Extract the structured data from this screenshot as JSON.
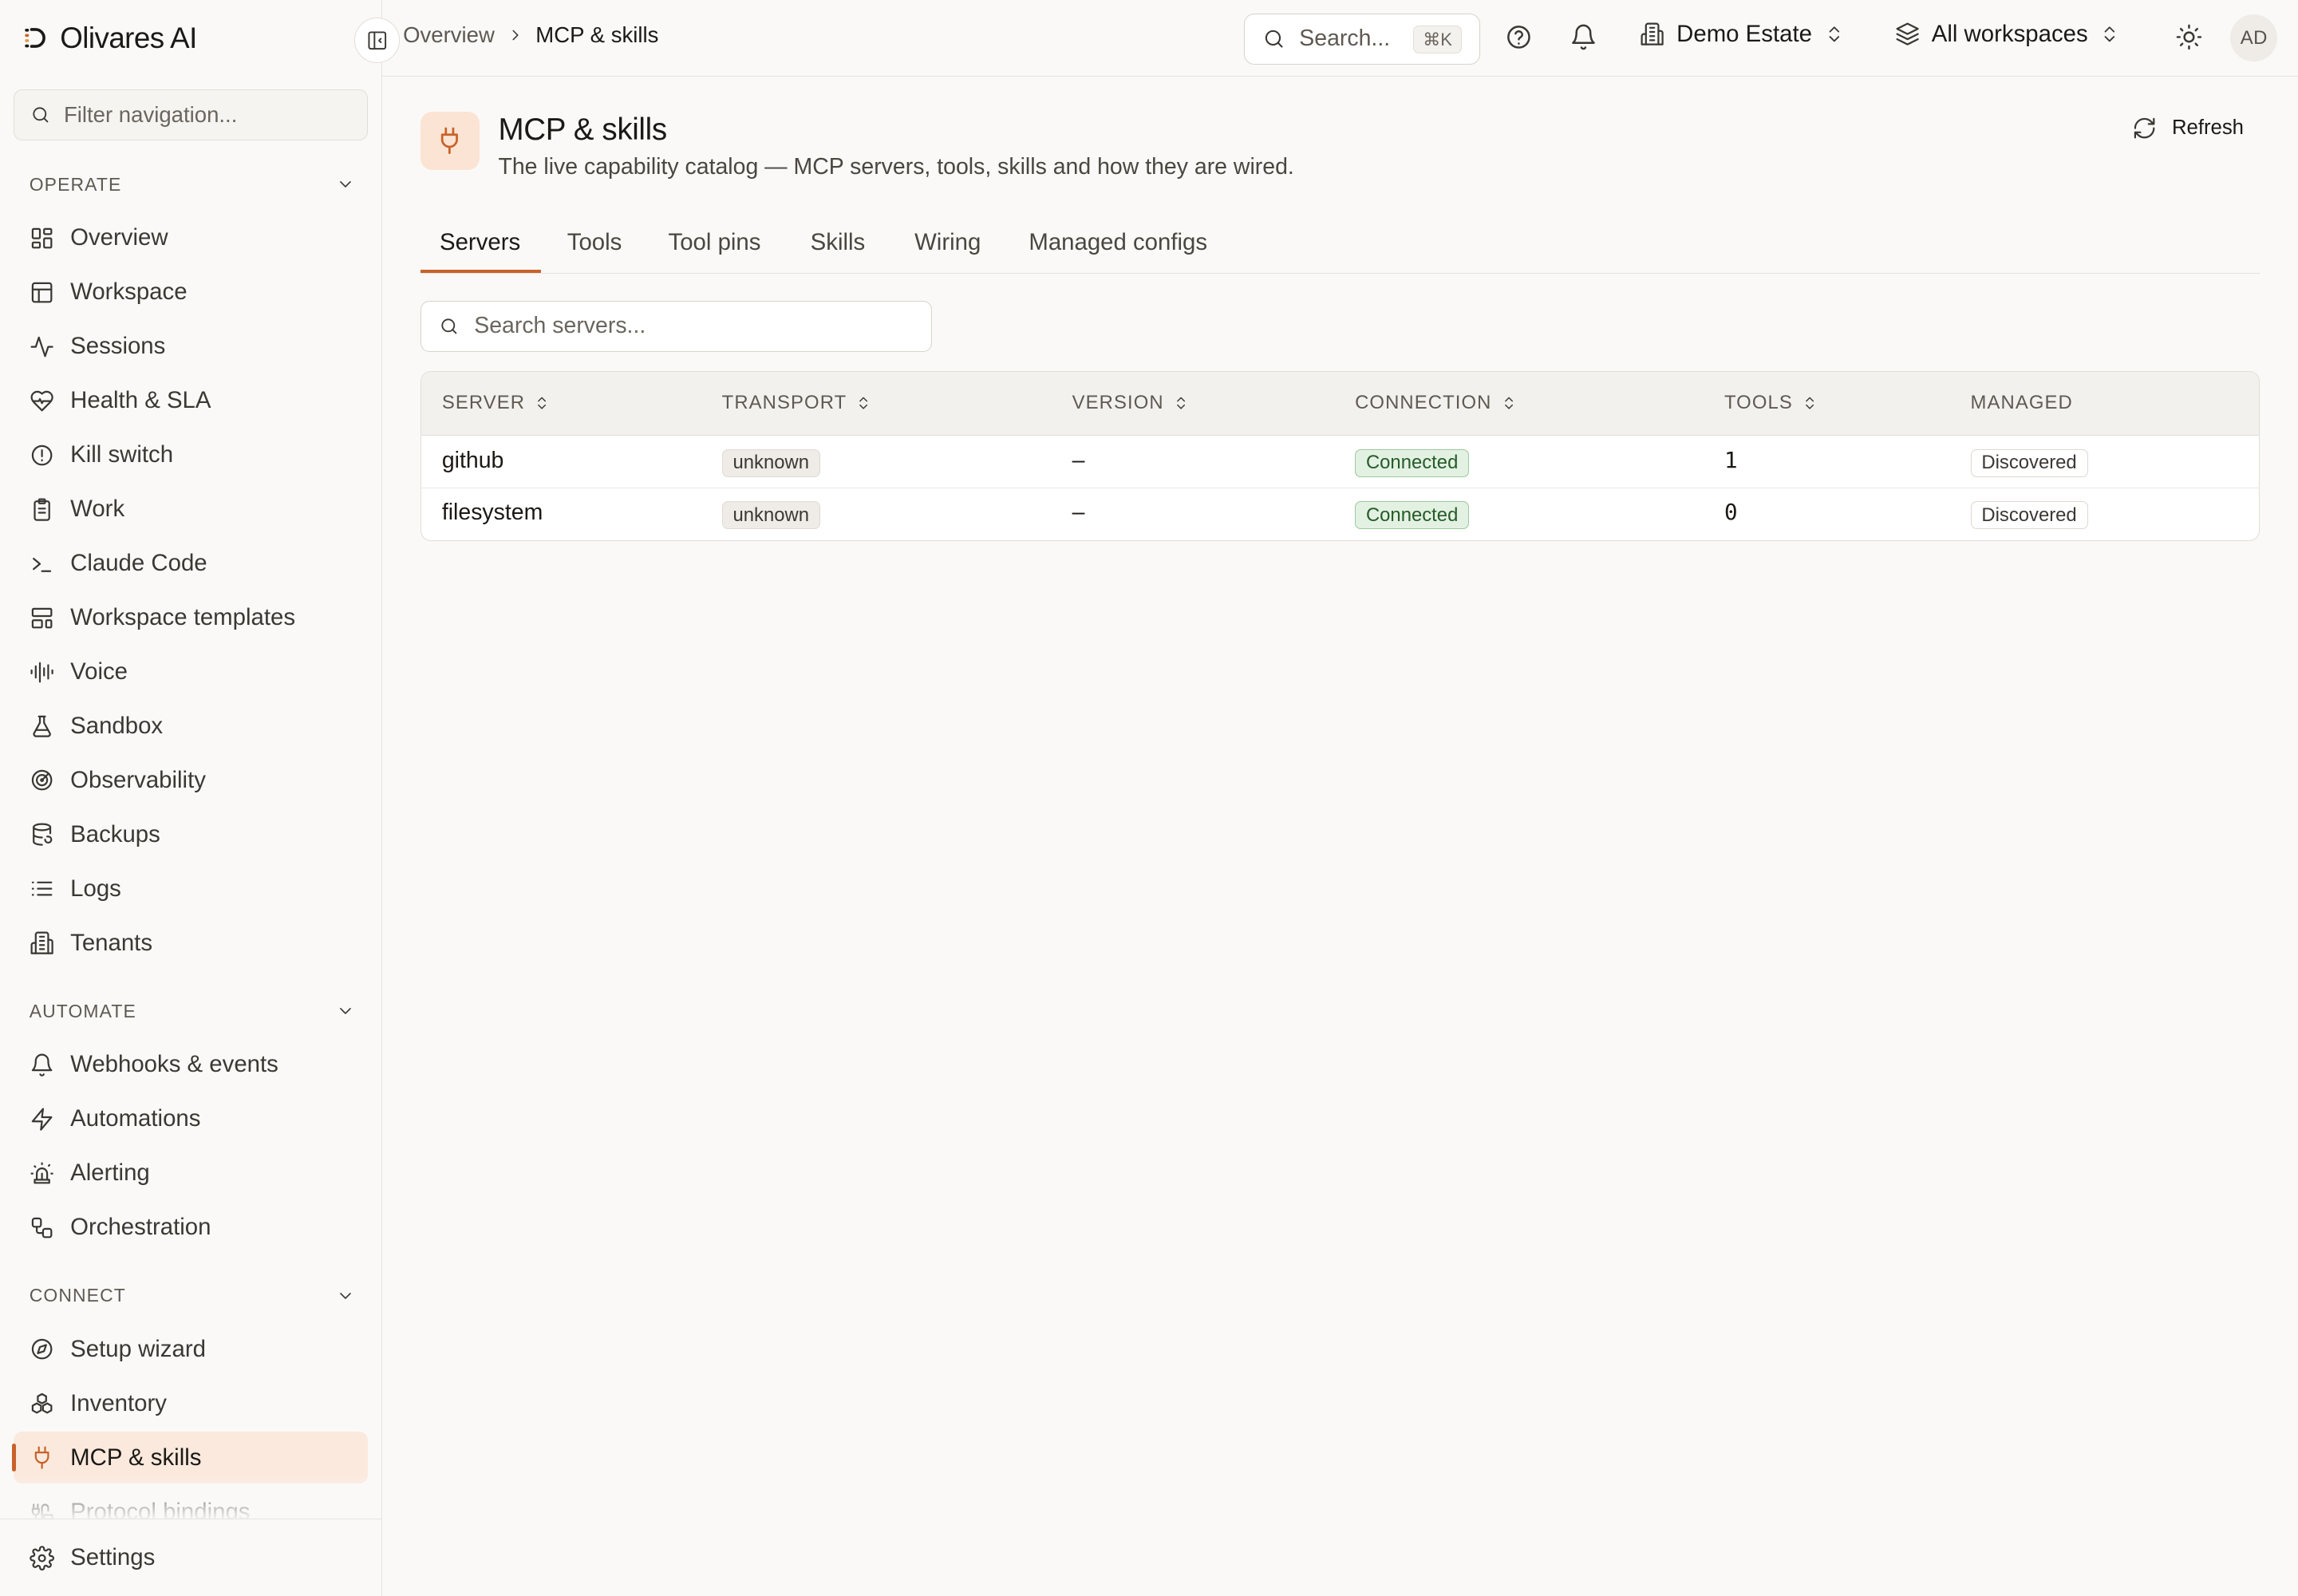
{
  "app": {
    "name": "Olivares AI"
  },
  "sidebar": {
    "filter_placeholder": "Filter navigation...",
    "sections": [
      {
        "title": "OPERATE",
        "items": [
          {
            "label": "Overview",
            "icon": "grid-icon"
          },
          {
            "label": "Workspace",
            "icon": "layout-icon"
          },
          {
            "label": "Sessions",
            "icon": "activity-icon"
          },
          {
            "label": "Health & SLA",
            "icon": "heart-pulse-icon"
          },
          {
            "label": "Kill switch",
            "icon": "alert-circle-icon"
          },
          {
            "label": "Work",
            "icon": "clipboard-icon"
          },
          {
            "label": "Claude Code",
            "icon": "terminal-icon"
          },
          {
            "label": "Workspace templates",
            "icon": "template-icon"
          },
          {
            "label": "Voice",
            "icon": "audio-lines-icon"
          },
          {
            "label": "Sandbox",
            "icon": "flask-icon"
          },
          {
            "label": "Observability",
            "icon": "radar-icon"
          },
          {
            "label": "Backups",
            "icon": "database-backup-icon"
          },
          {
            "label": "Logs",
            "icon": "list-icon"
          },
          {
            "label": "Tenants",
            "icon": "building-icon"
          }
        ]
      },
      {
        "title": "AUTOMATE",
        "items": [
          {
            "label": "Webhooks & events",
            "icon": "bell-icon"
          },
          {
            "label": "Automations",
            "icon": "zap-icon"
          },
          {
            "label": "Alerting",
            "icon": "siren-icon"
          },
          {
            "label": "Orchestration",
            "icon": "workflow-icon"
          }
        ]
      },
      {
        "title": "CONNECT",
        "items": [
          {
            "label": "Setup wizard",
            "icon": "compass-icon"
          },
          {
            "label": "Inventory",
            "icon": "boxes-icon"
          },
          {
            "label": "MCP & skills",
            "icon": "plug-icon",
            "active": true
          },
          {
            "label": "Protocol bindings",
            "icon": "cable-icon"
          }
        ]
      }
    ],
    "footer": {
      "label": "Settings",
      "icon": "gear-icon"
    }
  },
  "topbar": {
    "breadcrumb": [
      "Overview",
      "MCP & skills"
    ],
    "search_label": "Search...",
    "search_shortcut": "⌘K",
    "estate": "Demo Estate",
    "workspace": "All workspaces",
    "avatar_initials": "AD"
  },
  "page": {
    "title": "MCP & skills",
    "subtitle": "The live capability catalog — MCP servers, tools, skills and how they are wired.",
    "refresh_label": "Refresh",
    "tabs": [
      "Servers",
      "Tools",
      "Tool pins",
      "Skills",
      "Wiring",
      "Managed configs"
    ],
    "active_tab": "Servers",
    "search_placeholder": "Search servers..."
  },
  "table": {
    "columns": [
      "SERVER",
      "TRANSPORT",
      "VERSION",
      "CONNECTION",
      "TOOLS",
      "MANAGED"
    ],
    "rows": [
      {
        "server": "github",
        "transport": "unknown",
        "version": "–",
        "connection": "Connected",
        "tools": "1",
        "managed": "Discovered"
      },
      {
        "server": "filesystem",
        "transport": "unknown",
        "version": "–",
        "connection": "Connected",
        "tools": "0",
        "managed": "Discovered"
      }
    ]
  },
  "colors": {
    "accent": "#c8622a",
    "active_bg": "#fbe9dd",
    "connected_bg": "#e3f1e3",
    "connected_text": "#255c27"
  }
}
